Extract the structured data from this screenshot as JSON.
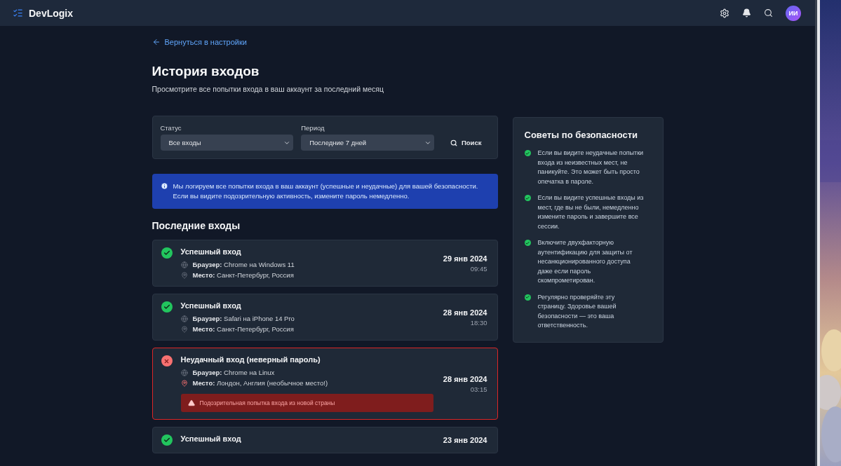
{
  "header": {
    "brand": "DevLogix",
    "avatar": "ИИ"
  },
  "back_link": "Вернуться в настройки",
  "title": "История входов",
  "subtitle": "Просмотрите все попытки входа в ваш аккаунт за последний месяц",
  "filters": [
    {
      "label": "Статус",
      "value": "Все входы"
    },
    {
      "label": "Период",
      "value": "Последние 7 дней"
    }
  ],
  "search_button": "Поиск",
  "info_banner": "Мы логируем все попытки входа в ваш аккаунт (успешные и неудачные) для вашей безопасности. Если вы видите подозрительную активность, измените пароль немедленно.",
  "section_title": "Последние входы",
  "entries": [
    {
      "failed": false,
      "title": "Успешный вход",
      "browser": "**Браузер:** Chrome на Windows 11",
      "location": "**Место:** Санкт-Петербург, Россия",
      "location_flagged": false,
      "date": "29 янв 2024",
      "time": "09:45"
    },
    {
      "failed": false,
      "title": "Успешный вход",
      "browser": "**Браузер:** Safari на iPhone 14 Pro",
      "location": "**Место:** Санкт-Петербург, Россия",
      "location_flagged": false,
      "date": "28 янв 2024",
      "time": "18:30"
    },
    {
      "failed": true,
      "title": "Неудачный вход (неверный пароль)",
      "browser": "**Браузер:** Chrome на Linux",
      "location": "**Место:** Лондон, Англия (необычное место!)",
      "location_flagged": true,
      "warning": "Подозрительная попытка входа из новой страны",
      "date": "28 янв 2024",
      "time": "03:15"
    },
    {
      "failed": false,
      "title": "Успешный вход",
      "date": "23 янв 2024"
    }
  ],
  "tips": {
    "title": "Советы по безопасности",
    "items": [
      "Если вы видите неудачные попытки входа из неизвестных мест, не паникуйте. Это может быть просто опечатка в пароле.",
      "Если вы видите успешные входы из мест, где вы не были, немедленно измените пароль и завершите все сессии.",
      "Включите двухфакторную аутентификацию для защиты от несанкционированного доступа даже если пароль скомпрометирован.",
      "Регулярно проверяйте эту страницу. Здоровье вашей безопасности — это ваша ответственность."
    ]
  }
}
